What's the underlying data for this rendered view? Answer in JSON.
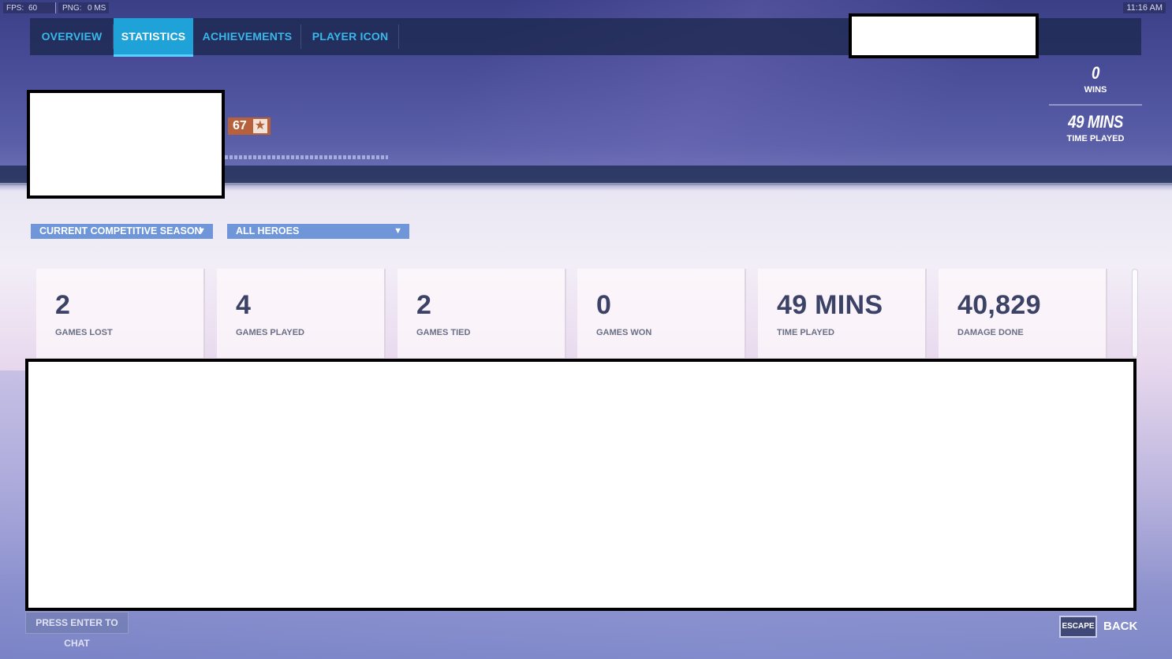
{
  "status_bar": {
    "fps_label": "FPS:",
    "fps_value": "60",
    "ping_label": "PNG:",
    "ping_value": "0 MS",
    "clock": "11:16 AM"
  },
  "nav": {
    "tabs": [
      {
        "label": "OVERVIEW",
        "active": false
      },
      {
        "label": "STATISTICS",
        "active": true
      },
      {
        "label": "ACHIEVEMENTS",
        "active": false
      },
      {
        "label": "PLAYER ICON",
        "active": false
      }
    ]
  },
  "player": {
    "level": "67",
    "level_icon": "star-icon"
  },
  "summary": {
    "wins_value": "0",
    "wins_label": "WINS",
    "time_value": "49 MINS",
    "time_label": "TIME PLAYED"
  },
  "filters": {
    "season": "CURRENT COMPETITIVE SEASON",
    "heroes": "ALL HEROES"
  },
  "stats": [
    {
      "value": "2",
      "label": "GAMES LOST"
    },
    {
      "value": "4",
      "label": "GAMES PLAYED"
    },
    {
      "value": "2",
      "label": "GAMES TIED"
    },
    {
      "value": "0",
      "label": "GAMES WON"
    },
    {
      "value": "49 MINS",
      "label": "TIME PLAYED"
    },
    {
      "value": "40,829",
      "label": "DAMAGE DONE"
    }
  ],
  "footer": {
    "chat_hint": "PRESS ENTER TO CHAT",
    "escape_key": "ESCAPE",
    "back_label": "BACK"
  },
  "colors": {
    "nav_accent": "#1fa2d8",
    "tab_text": "#38b8ea",
    "level_badge": "#b6613b",
    "dropdown": "#6e96d8"
  }
}
